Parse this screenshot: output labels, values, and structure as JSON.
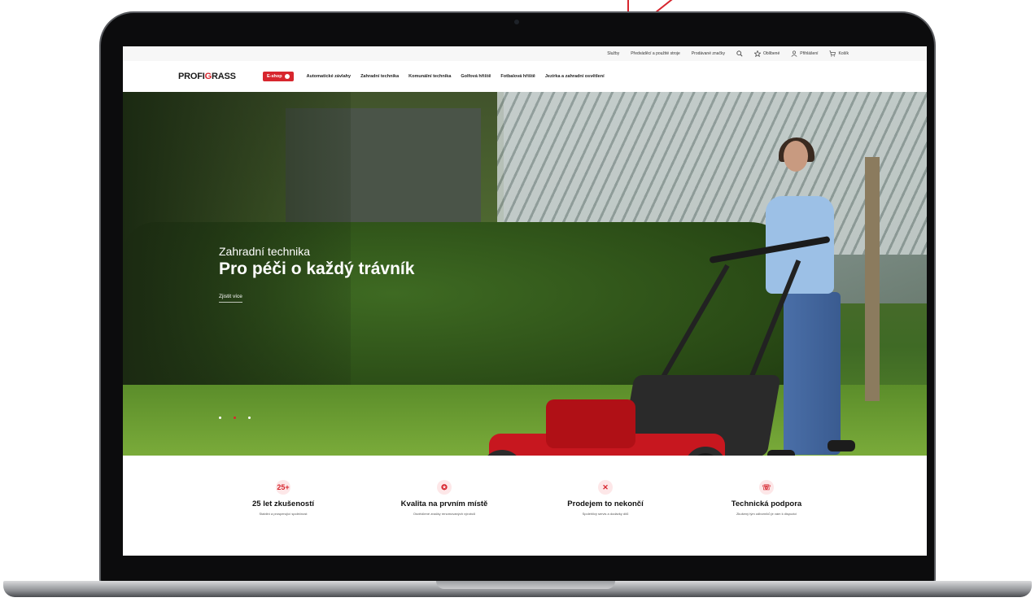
{
  "utility_bar": {
    "links": [
      "Služby",
      "Předváděcí a použité stroje",
      "Prodávané značky"
    ],
    "search_icon": "search-icon",
    "favorites_label": "Oblíbené",
    "login_label": "Přihlášení",
    "cart_label": "Košík"
  },
  "nav": {
    "logo_part1": "PROFI",
    "logo_part2": "G",
    "logo_part3": "RASS",
    "eshop_label": "E-shop",
    "links": [
      "Automatické závlahy",
      "Zahradní technika",
      "Komunální technika",
      "Golfová hřiště",
      "Fotbalová hřiště",
      "Jezírka a zahradní osvětlení"
    ]
  },
  "hero": {
    "subtitle": "Zahradní technika",
    "title": "Pro péči o každý trávník",
    "cta": "Zjistit více",
    "slides": 3,
    "active_slide": 2
  },
  "features": [
    {
      "icon": "25plus-years-icon",
      "icon_text": "25+",
      "title": "25 let zkušeností",
      "desc": "Stabilní a prosperující společnost"
    },
    {
      "icon": "quality-badge-icon",
      "icon_text": "✪",
      "title": "Kvalita na prvním místě",
      "desc": "Osvědčené značky renomovaných výrobců"
    },
    {
      "icon": "tools-icon",
      "icon_text": "✕",
      "title": "Prodejem to nekončí",
      "desc": "Spolehlivý servis a dodávky dílů"
    },
    {
      "icon": "support-headset-icon",
      "icon_text": "☏",
      "title": "Technická podpora",
      "desc": "Zkušený tým odborníků je vám k dispozici"
    }
  ],
  "colors": {
    "brand_red": "#d7262e"
  }
}
